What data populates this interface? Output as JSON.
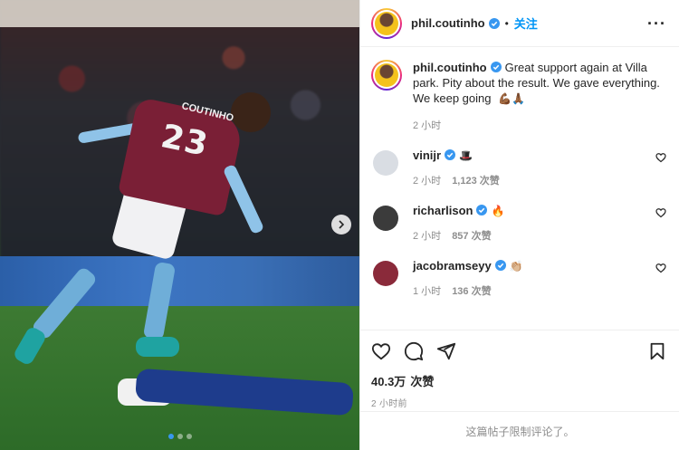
{
  "post": {
    "username": "phil.coutinho",
    "follow_label": "关注",
    "bullet": "•",
    "more_label": "···",
    "caption": "Great support again at Villa park. Pity about the result. We gave everything. We keep going",
    "caption_emojis": "💪🏾🙏🏾",
    "caption_time": "2 小时",
    "jersey_number": "23",
    "jersey_name": "COUTINHO",
    "carousel_dots": 3,
    "active_dot": 0
  },
  "comments": [
    {
      "username": "vinijr",
      "text": "🎩",
      "time": "2 小时",
      "likes": "1,123 次赞",
      "avatar_color": "#d9dde3"
    },
    {
      "username": "richarlison",
      "text": "🔥",
      "time": "2 小时",
      "likes": "857 次赞",
      "avatar_color": "#3b3b3b"
    },
    {
      "username": "jacobramseyy",
      "text": "👏🏼",
      "time": "1 小时",
      "likes": "136 次赞",
      "avatar_color": "#8a2a3a"
    }
  ],
  "footer": {
    "likes_count": "40.3万",
    "likes_label": "次赞",
    "posted_ago": "2 小时前",
    "comments_restricted": "这篇帖子限制评论了。"
  },
  "icons": {
    "like": "heart-icon",
    "comment": "comment-icon",
    "share": "paper-plane-icon",
    "save": "bookmark-icon",
    "verified": "verified-badge-icon",
    "next": "chevron-right-icon"
  },
  "colors": {
    "accent": "#0095f6",
    "verified": "#3897f0",
    "muted": "#8e8e8e",
    "text": "#262626"
  }
}
